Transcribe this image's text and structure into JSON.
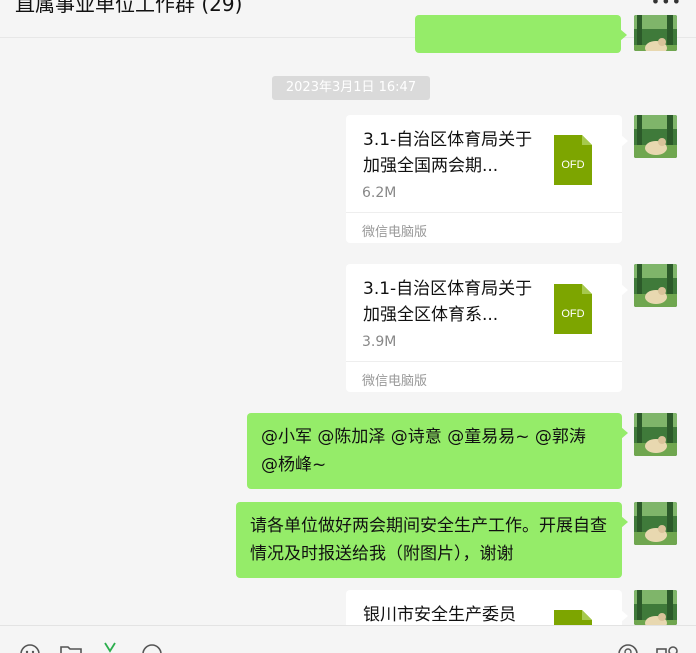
{
  "chat": {
    "title": "直属事业单位工作群 (29)",
    "more_icon": "ellipsis-icon"
  },
  "timestamp": "2023年3月1日 16:47",
  "files": [
    {
      "name": "3.1-自治区体育局关于加强全国两会期...",
      "size": "6.2M",
      "type": "OFD",
      "source": "微信电脑版"
    },
    {
      "name": "3.1-自治区体育局关于加强全区体育系...",
      "size": "3.9M",
      "type": "OFD",
      "source": "微信电脑版"
    },
    {
      "name": "银川市安全生产委员",
      "type": "OFD"
    }
  ],
  "messages": [
    {
      "text": "@小军 @陈加泽 @诗意 @童易易~ @郭涛 @杨峰~"
    },
    {
      "text": "请各单位做好两会期间安全生产工作。开展自查情况及时报送给我（附图片），谢谢"
    }
  ],
  "toolbar": {
    "icons": [
      "emoji-icon",
      "folder-icon",
      "scissors-icon",
      "chat-history-icon",
      "voice-call-icon",
      "video-call-icon"
    ]
  },
  "colors": {
    "my_bubble": "#95ec69",
    "file_icon": "#7da500",
    "background": "#f5f5f5"
  }
}
